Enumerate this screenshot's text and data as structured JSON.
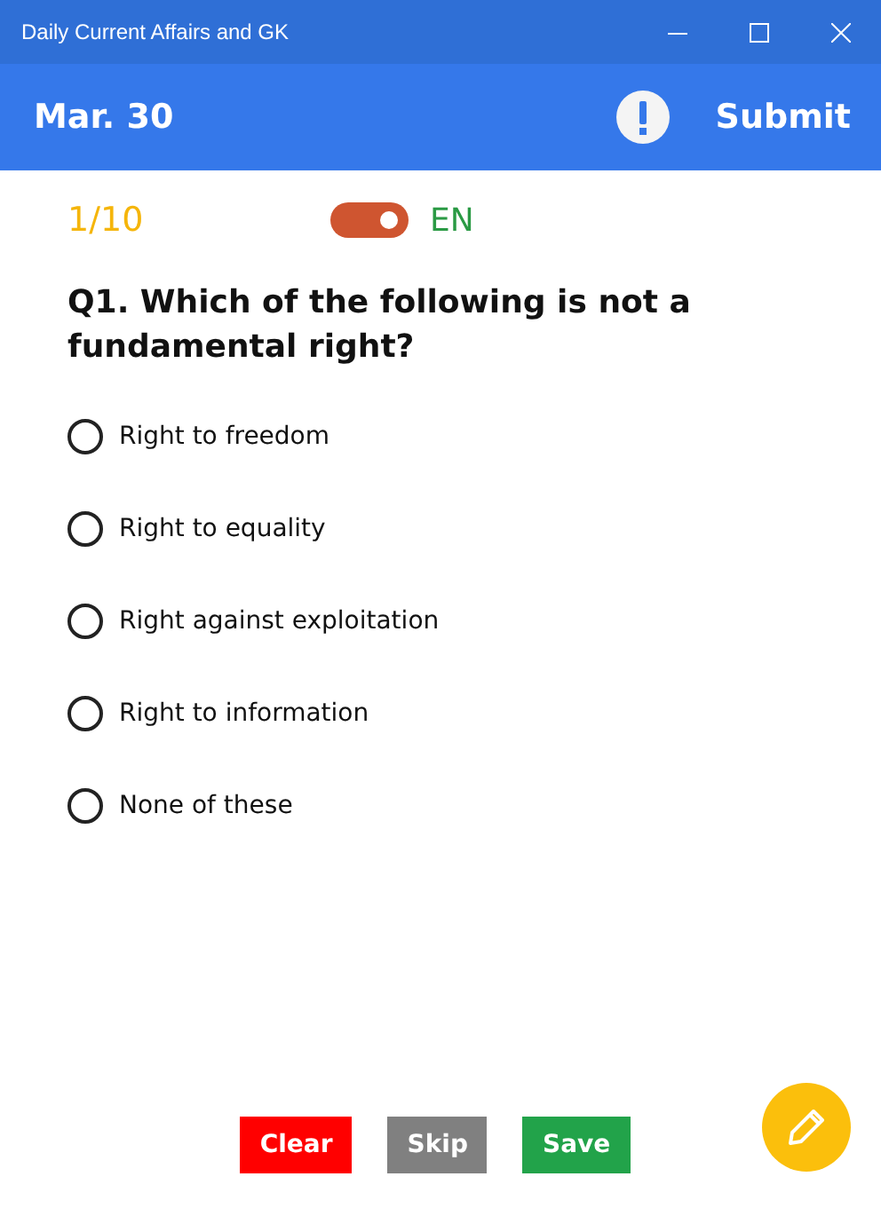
{
  "window": {
    "title": "Daily Current Affairs and GK"
  },
  "header": {
    "date": "Mar. 30",
    "submit": "Submit"
  },
  "progress": "1/10",
  "language": {
    "on": true,
    "label": "EN"
  },
  "question": "Q1. Which of the following is not a fundamental right?",
  "options": [
    {
      "label": "Right to freedom",
      "selected": false
    },
    {
      "label": "Right to equality",
      "selected": false
    },
    {
      "label": "Right against exploitation",
      "selected": false
    },
    {
      "label": "Right to information",
      "selected": false
    },
    {
      "label": "None of these",
      "selected": false
    }
  ],
  "buttons": [
    {
      "label": "Clear",
      "kind": "clear"
    },
    {
      "label": "Skip",
      "kind": "skip"
    },
    {
      "label": "Save",
      "kind": "save"
    }
  ]
}
